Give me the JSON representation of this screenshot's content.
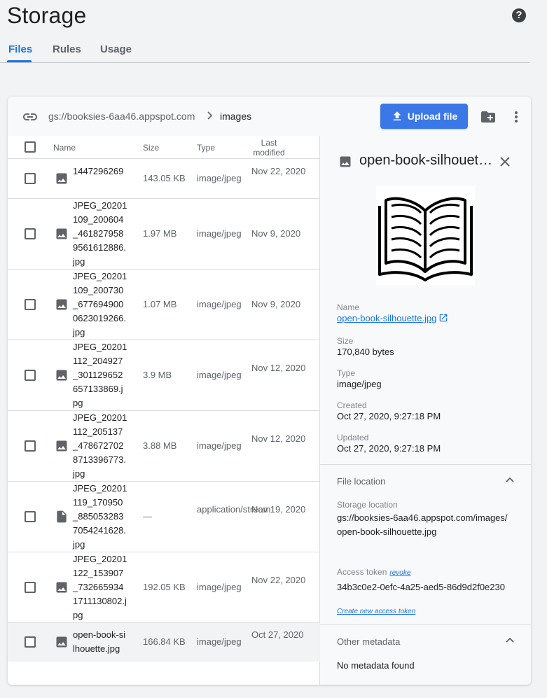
{
  "page": {
    "title": "Storage",
    "tabs": [
      {
        "label": "Files",
        "active": true
      },
      {
        "label": "Rules",
        "active": false
      },
      {
        "label": "Usage",
        "active": false
      }
    ]
  },
  "toolbar": {
    "bucket_path": "gs://booksies-6aa46.appspot.com",
    "folder": "images",
    "upload_label": "Upload file"
  },
  "table": {
    "headers": {
      "name": "Name",
      "size": "Size",
      "type": "Type",
      "modified": "Last modified"
    },
    "rows": [
      {
        "name": "1447296269",
        "size": "143.05 KB",
        "type": "image/jpeg",
        "modified": "Nov 22, 2020",
        "icon": "image-icon"
      },
      {
        "name": "JPEG_20201109_200604_4618279589561612886.jpg",
        "size": "1.97 MB",
        "type": "image/jpeg",
        "modified": "Nov 9, 2020",
        "icon": "image-icon"
      },
      {
        "name": "JPEG_20201109_200730_6776949000623019266.jpg",
        "size": "1.07 MB",
        "type": "image/jpeg",
        "modified": "Nov 9, 2020",
        "icon": "image-icon"
      },
      {
        "name": "JPEG_20201112_204927_301129652657133869.jpg",
        "size": "3.9 MB",
        "type": "image/jpeg",
        "modified": "Nov 12, 2020",
        "icon": "image-icon"
      },
      {
        "name": "JPEG_20201112_205137_4786727028713396773.jpg",
        "size": "3.88 MB",
        "type": "image/jpeg",
        "modified": "Nov 12, 2020",
        "icon": "image-icon"
      },
      {
        "name": "JPEG_20201119_170950_8850532837054241628.jpg",
        "size": "—",
        "type": "application/stream",
        "modified": "Nov 19, 2020",
        "icon": "document-icon"
      },
      {
        "name": "JPEG_20201122_153907_7326659341711130802.jpg",
        "size": "192.05 KB",
        "type": "image/jpeg",
        "modified": "Nov 22, 2020",
        "icon": "image-icon"
      },
      {
        "name": "open-book-silhouette.jpg",
        "size": "166.84 KB",
        "type": "image/jpeg",
        "modified": "Oct 27, 2020",
        "icon": "image-icon",
        "selected": true
      }
    ]
  },
  "details": {
    "title": "open-book-silhouette.jpg",
    "name_label": "Name",
    "name_value": "open-book-silhouette.jpg",
    "size_label": "Size",
    "size_value": "170,840 bytes",
    "type_label": "Type",
    "type_value": "image/jpeg",
    "created_label": "Created",
    "created_value": "Oct 27, 2020, 9:27:18 PM",
    "updated_label": "Updated",
    "updated_value": "Oct 27, 2020, 9:27:18 PM",
    "file_location_header": "File location",
    "storage_location_label": "Storage location",
    "storage_location_value": "gs://booksies-6aa46.appspot.com/images/open-book-silhouette.jpg",
    "access_token_label": "Access token",
    "revoke_label": "revoke",
    "access_token_value": "34b3c0e2-0efc-4a25-aed5-86d9d2f0e230",
    "create_token_label": "Create new access token",
    "other_metadata_header": "Other metadata",
    "no_metadata": "No metadata found"
  },
  "colors": {
    "accent": "#1a73e8",
    "upload_button": "#3b78e7"
  }
}
